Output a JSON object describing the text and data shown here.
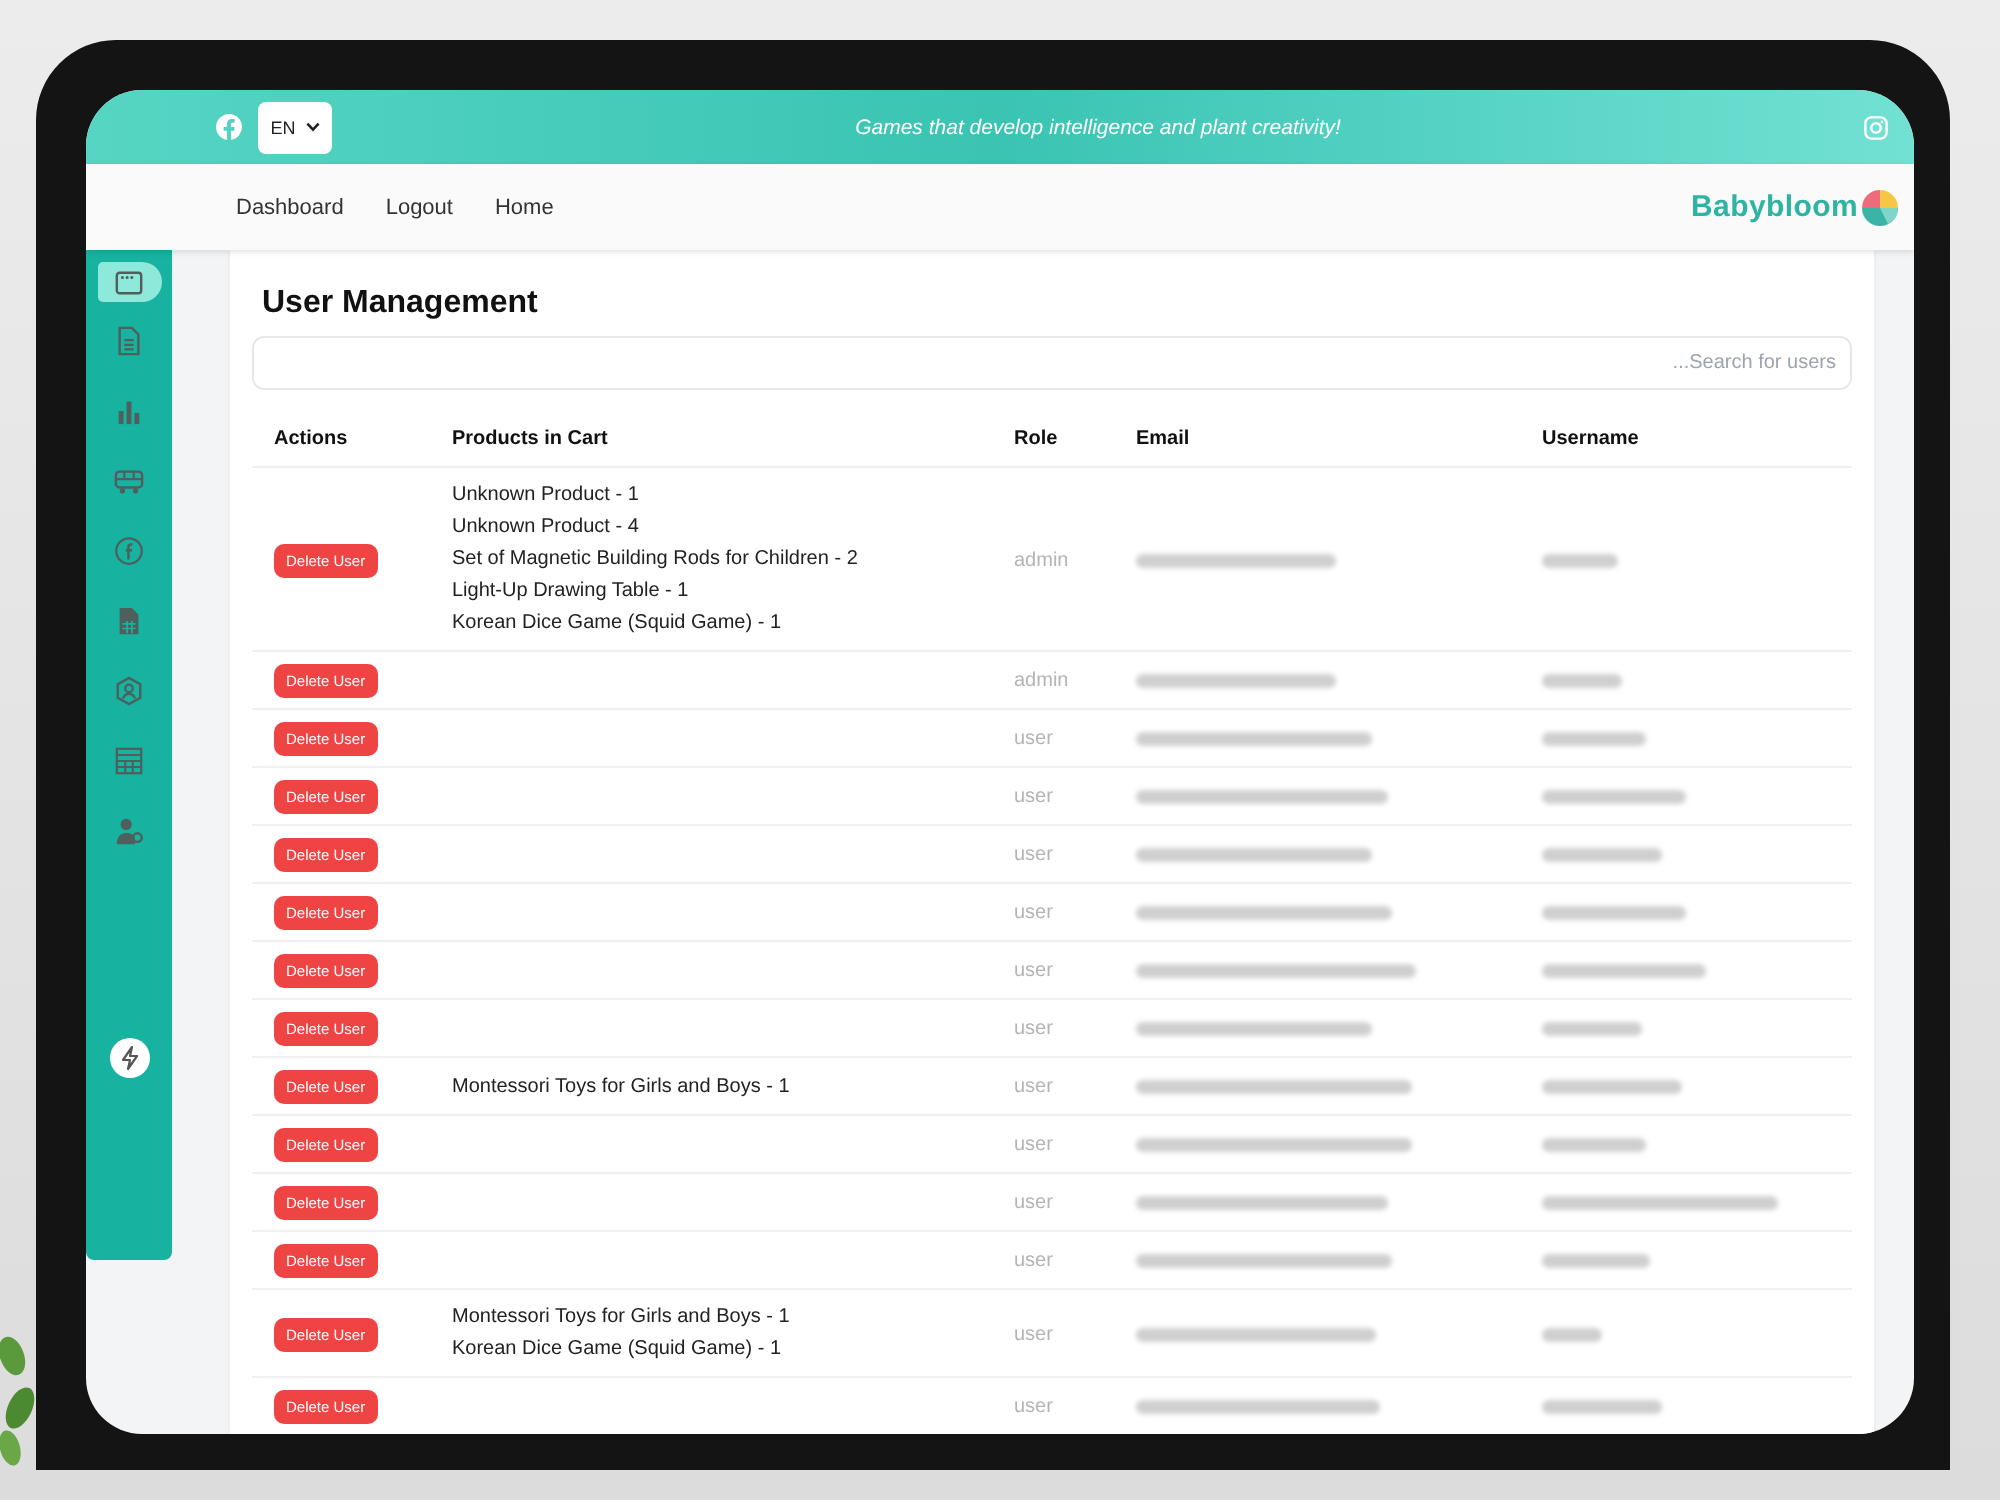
{
  "top_bar": {
    "language_select": {
      "value": "EN"
    },
    "tagline": "Games that develop intelligence and plant creativity!"
  },
  "nav": {
    "links": [
      "Dashboard",
      "Logout",
      "Home"
    ],
    "logo": "Babybloom"
  },
  "sidebar": {
    "items": [
      {
        "selected": true
      },
      {
        "selected": false
      },
      {
        "selected": false
      },
      {
        "selected": false
      },
      {
        "selected": false
      },
      {
        "selected": false
      },
      {
        "selected": false
      },
      {
        "selected": false
      },
      {
        "selected": false
      }
    ]
  },
  "page": {
    "title": "User Management",
    "search": {
      "placeholder": "...Search for users"
    }
  },
  "table": {
    "columns": [
      "Actions",
      "Products in Cart",
      "Role",
      "Email",
      "Username"
    ],
    "rows": [
      {
        "action": "Delete User",
        "products": [
          "Unknown Product - 1",
          "Unknown Product - 4",
          "Set of Magnetic Building Rods for Children - 2",
          "Light-Up Drawing Table - 1",
          "Korean Dice Game (Squid Game) - 1"
        ],
        "role": "admin"
      },
      {
        "action": "Delete User",
        "role": "admin"
      },
      {
        "action": "Delete User",
        "role": "user"
      },
      {
        "action": "Delete User",
        "role": "user"
      },
      {
        "action": "Delete User",
        "role": "user"
      },
      {
        "action": "Delete User",
        "role": "user"
      },
      {
        "action": "Delete User",
        "role": "user"
      },
      {
        "action": "Delete User",
        "role": "user"
      },
      {
        "action": "Delete User",
        "products": [
          "Montessori Toys for Girls and Boys - 1"
        ],
        "role": "user"
      },
      {
        "action": "Delete User",
        "role": "user"
      },
      {
        "action": "Delete User",
        "role": "user"
      },
      {
        "action": "Delete User",
        "role": "user"
      },
      {
        "action": "Delete User",
        "products": [
          "Montessori Toys for Girls and Boys - 1",
          "Korean Dice Game (Squid Game) - 1"
        ],
        "role": "user"
      },
      {
        "action": "Delete User",
        "role": "user"
      }
    ]
  }
}
